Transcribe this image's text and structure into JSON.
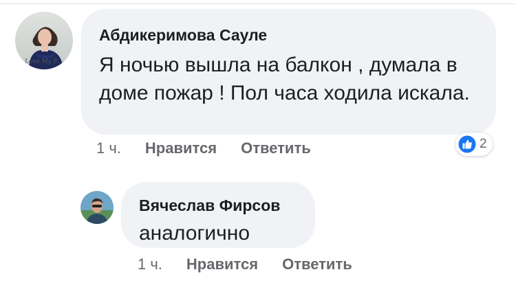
{
  "comments": [
    {
      "author": "Абдикеримова Сауле",
      "text": "Я ночью вышла на балкон , думала в доме пожар ! Пол часа ходила искала.",
      "avatar_caption": "Love My F...",
      "time": "1 ч.",
      "like_label": "Нравится",
      "reply_label": "Ответить",
      "reactions": {
        "icon": "like-icon",
        "count": "2"
      }
    },
    {
      "author": "Вячеслав Фирсов",
      "text": "аналогично",
      "time": "1 ч.",
      "like_label": "Нравится",
      "reply_label": "Ответить"
    }
  ],
  "colors": {
    "bubble_bg": "#f0f2f5",
    "meta_text": "#65676b",
    "like_blue": "#1877f2"
  }
}
